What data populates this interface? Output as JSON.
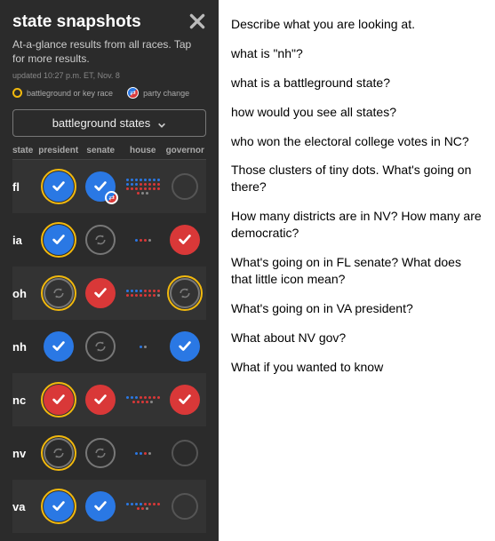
{
  "panel": {
    "title": "state snapshots",
    "subtitle": "At-a-glance results from all races. Tap for more results.",
    "updated": "updated 10:27 p.m. ET, Nov. 8",
    "legend_battleground": "battleground or key race",
    "legend_flip": "party change",
    "filter_label": "battleground states",
    "columns": {
      "state": "state",
      "president": "president",
      "senate": "senate",
      "house": "house",
      "governor": "governor"
    }
  },
  "rows": [
    {
      "abbr": "fl",
      "president": {
        "type": "win",
        "color": "blue",
        "battleground": true
      },
      "senate": {
        "type": "win",
        "color": "blue",
        "flip": true
      },
      "house": {
        "type": "dots",
        "blue": 11,
        "red": 14,
        "grey": 2
      },
      "governor": {
        "type": "empty"
      }
    },
    {
      "abbr": "ia",
      "president": {
        "type": "win",
        "color": "blue",
        "battleground": true
      },
      "senate": {
        "type": "pending"
      },
      "house": {
        "type": "dots",
        "blue": 1,
        "red": 2,
        "grey": 1
      },
      "governor": {
        "type": "win",
        "color": "red"
      }
    },
    {
      "abbr": "oh",
      "president": {
        "type": "pending",
        "battleground": true
      },
      "senate": {
        "type": "win",
        "color": "red"
      },
      "house": {
        "type": "dots",
        "blue": 4,
        "red": 11,
        "grey": 1
      },
      "governor": {
        "type": "pending",
        "battleground": true
      }
    },
    {
      "abbr": "nh",
      "president": {
        "type": "win",
        "color": "blue"
      },
      "senate": {
        "type": "pending"
      },
      "house": {
        "type": "dots",
        "blue": 1,
        "grey": 1
      },
      "governor": {
        "type": "win",
        "color": "blue"
      }
    },
    {
      "abbr": "nc",
      "president": {
        "type": "win",
        "color": "red",
        "battleground": true
      },
      "senate": {
        "type": "win",
        "color": "red"
      },
      "house": {
        "type": "dots",
        "blue": 3,
        "red": 9,
        "grey": 1
      },
      "governor": {
        "type": "win",
        "color": "red"
      }
    },
    {
      "abbr": "nv",
      "president": {
        "type": "pending",
        "battleground": true
      },
      "senate": {
        "type": "pending"
      },
      "house": {
        "type": "dots",
        "blue": 2,
        "red": 1,
        "grey": 1
      },
      "governor": {
        "type": "empty"
      }
    },
    {
      "abbr": "va",
      "president": {
        "type": "win",
        "color": "blue",
        "battleground": true
      },
      "senate": {
        "type": "win",
        "color": "blue"
      },
      "house": {
        "type": "dots",
        "blue": 4,
        "red": 6,
        "grey": 1
      },
      "governor": {
        "type": "empty"
      }
    }
  ],
  "questions": [
    "Describe what you are looking at.",
    "what is \"nh\"?",
    "what is a battleground state?",
    "how would you see all states?",
    "who won the electoral college votes in NC?",
    "Those clusters of tiny dots. What's going on there?",
    "How many districts are in NV? How many are democratic?",
    "What's going on in FL senate? What does that little icon mean?",
    "What's going on in VA president?",
    "What about NV gov?",
    "What if you wanted to know"
  ]
}
